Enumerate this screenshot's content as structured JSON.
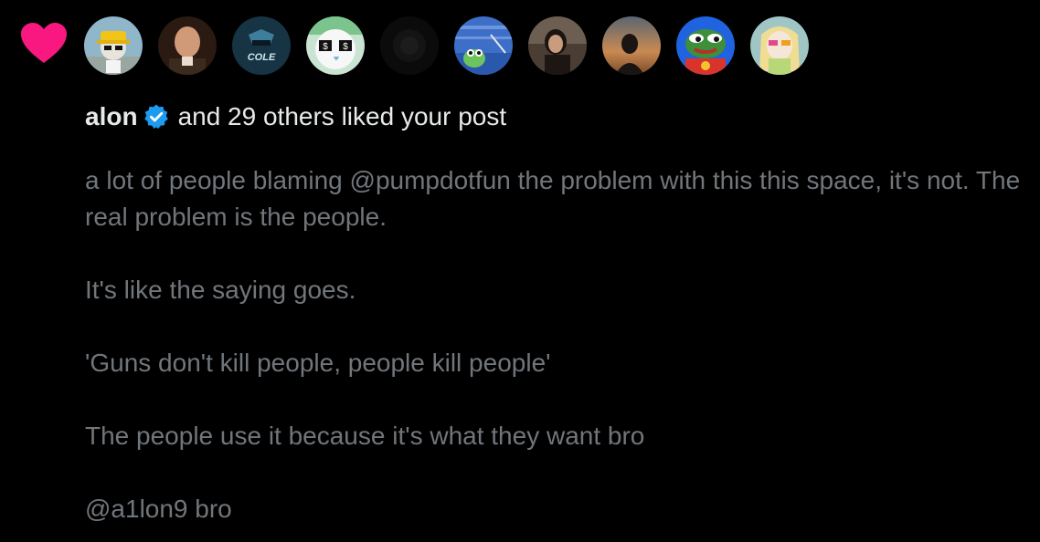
{
  "notification": {
    "type_icon": "heart-icon",
    "heart_color": "#f91880",
    "verified_color": "#1d9bf0",
    "liker_name": "alon",
    "liker_suffix": "and 29 others liked your post",
    "avatars": [
      {
        "name": "avatar-1",
        "description": "cartoon character with yellow hard hat"
      },
      {
        "name": "avatar-2",
        "description": "bald man photo"
      },
      {
        "name": "avatar-3",
        "description": "logo with text",
        "text": "COLE"
      },
      {
        "name": "avatar-4",
        "description": "cartoon with dollar sign eyes"
      },
      {
        "name": "avatar-5",
        "description": "dark avatar"
      },
      {
        "name": "avatar-6",
        "description": "blue frog pixel art"
      },
      {
        "name": "avatar-7",
        "description": "woman photo"
      },
      {
        "name": "avatar-8",
        "description": "sunset silhouette"
      },
      {
        "name": "avatar-9",
        "description": "pepe frog red shirt"
      },
      {
        "name": "avatar-10",
        "description": "blonde cartoon with sunglasses"
      }
    ],
    "post": {
      "paragraphs": [
        "a lot of people blaming @pumpdotfun the problem with this this space, it's not. The real problem is the people.",
        "It's like the saying goes.",
        "'Guns don't kill people, people kill people'",
        "The people use it because it's what they want bro",
        "@a1lon9 bro"
      ]
    }
  }
}
